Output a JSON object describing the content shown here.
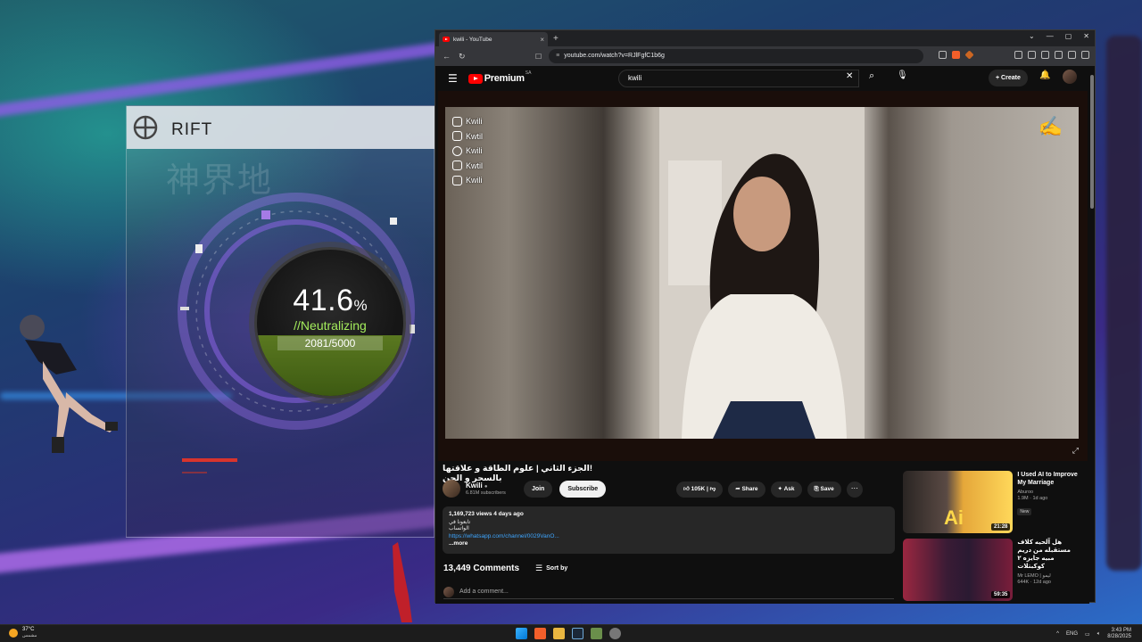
{
  "rift": {
    "subtitle": "",
    "title": "RIFT",
    "watermark": "神界地",
    "percent": "41.6",
    "percent_sign": "%",
    "status": "//Neutralizing",
    "progress_text": "2081/5000",
    "progress_fraction": 0.416
  },
  "browser": {
    "tab_title": "kwili - YouTube",
    "url": "youtube.com/watch?v=RJlFgfC1b6g",
    "tab_close": "×",
    "new_tab": "+"
  },
  "youtube": {
    "logo_text": "Premium",
    "country_code": "SA",
    "search_value": "kwili",
    "create_label": "Create",
    "overlay_handles": [
      {
        "icon": "youtube-icon",
        "label": "Kwili"
      },
      {
        "icon": "instagram-icon",
        "label": "Kwtil"
      },
      {
        "icon": "snapchat-icon",
        "label": "Kwili"
      },
      {
        "icon": "twitter-icon",
        "label": "Kwtil"
      },
      {
        "icon": "tiktok-icon",
        "label": "Kwili"
      }
    ],
    "video_title": "!الجزء الثاني | علوم الطاقة و علاقتها بالسحر و الجن",
    "channel_name": "Kwili",
    "subscribers": "6.81M subscribers",
    "join_label": "Join",
    "subscribe_label": "Subscribe",
    "likes": "105K",
    "share_label": "Share",
    "ask_label": "Ask",
    "save_label": "Save",
    "views_and_date": "1,169,723 views  4 days ago",
    "desc_line": "تابعونا في الواتساب",
    "desc_link": "https://whatsapp.com/channel/0029VanO...",
    "more_label": "...more",
    "comments_count": "13,449 Comments",
    "sort_label": "Sort by",
    "add_comment_placeholder": "Add a comment...",
    "recommendations": [
      {
        "title": "I Used AI to Improve My Marriage",
        "channel": "Aburoo",
        "meta": "1.9M · 1d ago",
        "badge": "New",
        "duration": "21:28",
        "thumb_text": "Ai"
      },
      {
        "title": "هل آلحيه كلاف مستقبله من دريم مبيه جايزه ٢ كوكبتلات",
        "channel": "Mr LEMO | ليمو",
        "meta": "644K · 12d ago",
        "badge": "",
        "duration": "59:35",
        "thumb_text": ""
      }
    ]
  },
  "taskbar": {
    "temperature": "37°C",
    "weather_desc": "مشمس",
    "language": "ENG",
    "time": "3:43 PM",
    "date": "8/28/2025"
  }
}
